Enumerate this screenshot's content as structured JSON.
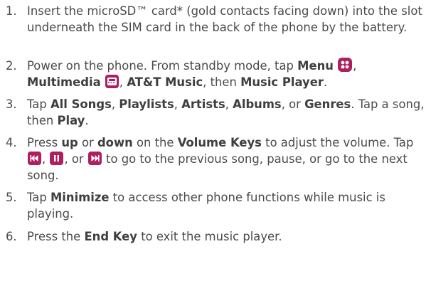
{
  "accent_color": "#ad1f5f",
  "steps": [
    {
      "num": "1.",
      "t1": "Insert the microSD™ card* (gold contacts facing down) into the slot underneath the SIM card in the back of the phone by the battery."
    },
    {
      "num": "2.",
      "t1": "Power on the phone. From standby mode, tap ",
      "b1": "Menu",
      "t2": ",",
      "b2": "Multimedia",
      "t3": ", ",
      "b3": "AT&T Music",
      "t4": ", then ",
      "b4": "Music Player",
      "t5": "."
    },
    {
      "num": "3.",
      "t1": "Tap ",
      "b1": "All Songs",
      "t2": ", ",
      "b2": "Playlists",
      "t3": ", ",
      "b3": "Artists",
      "t4": ", ",
      "b4": "Albums",
      "t5": ", or ",
      "b5": "Genres",
      "t6": ". Tap a song, then ",
      "b6": "Play",
      "t7": "."
    },
    {
      "num": "4.",
      "t1": "Press ",
      "b1": "up",
      "t2": " or ",
      "b2": "down",
      "t3": " on the ",
      "b3": "Volume Keys",
      "t4": " to adjust the volume. Tap ",
      "t5": ",",
      "t6": ", or",
      "t7": " to go to the previous song, pause, or go to the next song."
    },
    {
      "num": "5.",
      "t1": "Tap ",
      "b1": "Minimize",
      "t2": " to access other phone functions while music is playing."
    },
    {
      "num": "6.",
      "t1": "Press the ",
      "b1": "End Key",
      "t2": " to exit the music player."
    }
  ],
  "icons": [
    "menu-grid-icon",
    "multimedia-film-icon",
    "previous-song-icon",
    "pause-icon",
    "next-song-icon"
  ]
}
